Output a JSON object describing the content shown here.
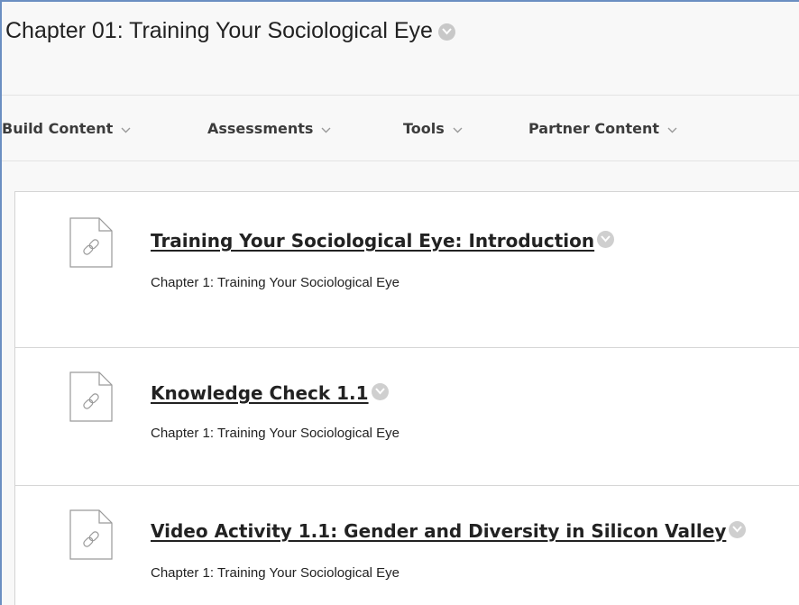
{
  "page": {
    "title": "Chapter 01: Training Your Sociological Eye"
  },
  "toolbar": {
    "buttons": [
      {
        "label": "Build Content"
      },
      {
        "label": "Assessments"
      },
      {
        "label": "Tools"
      },
      {
        "label": "Partner Content"
      }
    ]
  },
  "content_items": [
    {
      "title": "Training Your Sociological Eye: Introduction",
      "description": "Chapter 1: Training Your Sociological Eye",
      "icon": "web-link-document-icon"
    },
    {
      "title": "Knowledge Check 1.1",
      "description": "Chapter 1: Training Your Sociological Eye",
      "icon": "web-link-document-icon"
    },
    {
      "title": "Video Activity 1.1: Gender and Diversity in Silicon Valley",
      "description": "Chapter 1: Training Your Sociological Eye",
      "icon": "web-link-document-icon"
    }
  ],
  "colors": {
    "frame_border": "#6b8fc2",
    "background": "#f8f8f8",
    "chevron_circle": "#c8c8c8",
    "text": "#222222"
  }
}
